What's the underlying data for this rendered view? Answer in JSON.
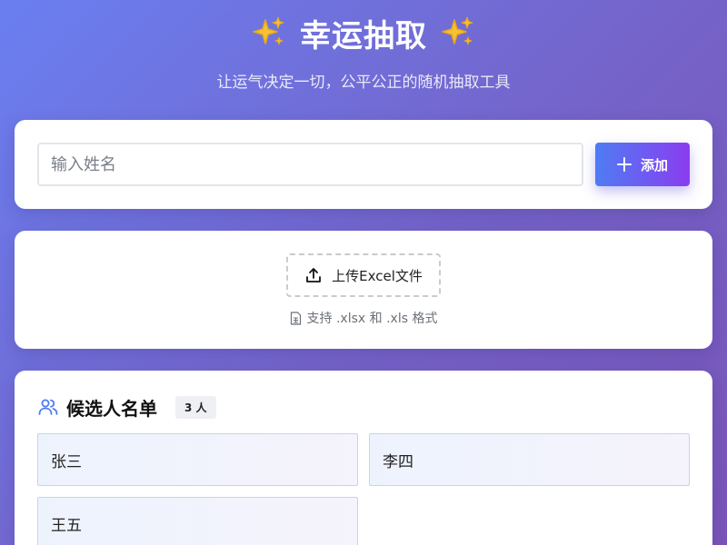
{
  "header": {
    "title": "幸运抽取",
    "subtitle": "让运气决定一切，公平公正的随机抽取工具",
    "sparkle_icon": "sparkles-icon",
    "sparkle_color": "#f6c234"
  },
  "add_form": {
    "input_placeholder": "输入姓名",
    "input_value": "",
    "add_label": "添加",
    "add_icon": "plus-icon"
  },
  "upload": {
    "button_label": "上传Excel文件",
    "button_icon": "upload-icon",
    "hint": "支持 .xlsx 和 .xls 格式",
    "hint_icon": "file-spreadsheet-icon"
  },
  "candidates": {
    "title": "候选人名单",
    "title_icon": "users-icon",
    "count": "3 人",
    "items": [
      "张三",
      "李四",
      "王五"
    ]
  },
  "colors": {
    "background_start": "#6a7ff0",
    "background_end": "#7a55b8",
    "accent_blue": "#4f7cf3",
    "accent_purple": "#8a3df0"
  }
}
